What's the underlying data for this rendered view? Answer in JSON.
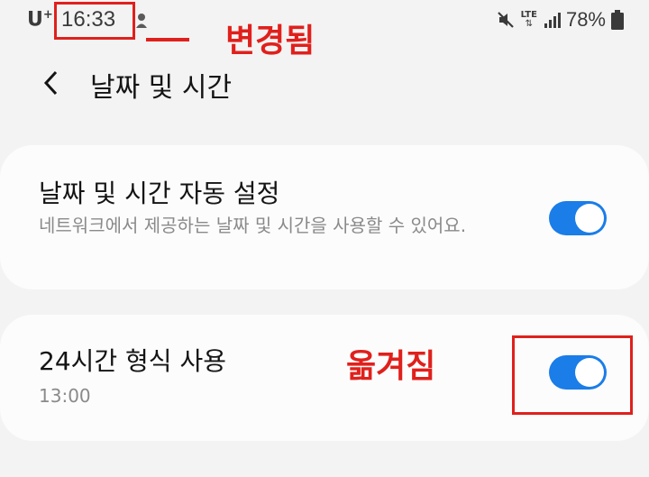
{
  "status_bar": {
    "carrier": "U",
    "carrier_sup": "+",
    "time": "16:33",
    "lte": "LTE",
    "battery": "78%"
  },
  "annotations": {
    "changed": "변경됨",
    "moved": "옮겨짐",
    "color": "#e0201c"
  },
  "header": {
    "title": "날짜 및 시간",
    "back_icon": "chevron-left-icon"
  },
  "settings": {
    "auto_datetime": {
      "title": "날짜 및 시간 자동 설정",
      "description": "네트워크에서 제공하는 날짜 및 시간을 사용할 수 있어요.",
      "enabled": true
    },
    "format_24h": {
      "title": "24시간 형식 사용",
      "example": "13:00",
      "enabled": true
    }
  },
  "colors": {
    "accent": "#1a7de8",
    "background": "#f3f3f3",
    "card": "#fcfcfc"
  }
}
